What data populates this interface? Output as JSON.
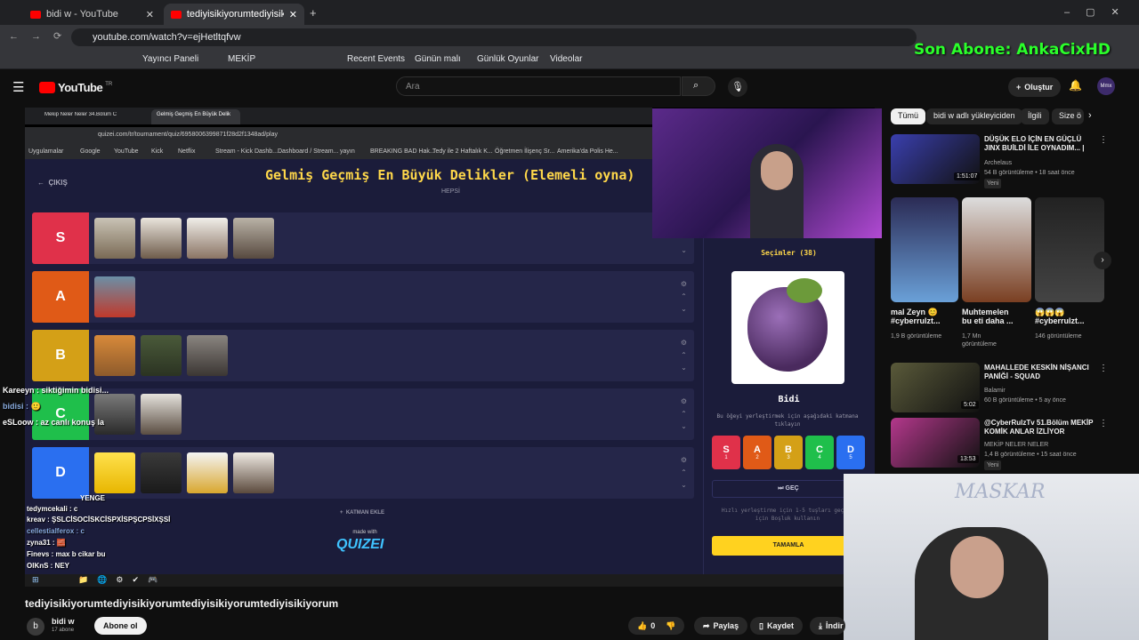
{
  "browser": {
    "tabs": [
      {
        "label": "bidi w - YouTube"
      },
      {
        "label": "tediyisikiyorumtediyisikiyor"
      }
    ],
    "url": "youtube.com/watch?v=ejHetltqfvw",
    "bookmarks": [
      "Yayıncı Paneli",
      "MEKİP",
      "Recent Events",
      "Günün malı",
      "Günlük Oyunlar",
      "Videolar"
    ]
  },
  "overlay": {
    "subscriber_text": "Son Abone: AnkaCixHD"
  },
  "youtube": {
    "logo": "YouTube",
    "logo_region": "TR",
    "search_placeholder": "Ara",
    "create_label": "Oluştur",
    "avatar_text": "Mmx"
  },
  "stream": {
    "inner_tabs": [
      "Mekip Neler Neler 34.Bölüm C",
      "Gelmiş Geçmiş En Büyük Delik"
    ],
    "inner_url": "quizei.com/tr/tournament/quiz/6958006399871f28d2f1348ad/play",
    "inner_bookmarks": [
      "Uygulamalar",
      "Google",
      "YouTube",
      "Kick",
      "Netflix",
      "Stream - Kick Dashb...",
      "Dashboard / Stream...",
      "yayın",
      "BREAKING BAD Hak...",
      "Tedy ile 2 Haftalık K...",
      "Öğretmen İlişenç Sr...",
      "Amerika'da Polis He..."
    ],
    "quiz": {
      "back_label": "ÇIKIŞ",
      "title": "Gelmiş Geçmiş En Büyük Delikler (Elemeli oyna)",
      "subtitle": "HEPSİ",
      "tiers": [
        {
          "label": "S",
          "color": "#e0314a"
        },
        {
          "label": "A",
          "color": "#e05a17"
        },
        {
          "label": "B",
          "color": "#d4a017"
        },
        {
          "label": "C",
          "color": "#1fbf4b"
        },
        {
          "label": "D",
          "color": "#2a6ff0"
        }
      ],
      "add_layer_label": "KATMAN EKLE",
      "made_with": "made with",
      "brand": "QUIZEI",
      "selections_label": "Seçimler (38)",
      "current_item": "Bidi",
      "instruction": "Bu öğeyi yerleştirmek için aşağıdaki katmana tıklayın",
      "tier_buttons": [
        {
          "label": "S",
          "key": "1",
          "color": "#e0314a"
        },
        {
          "label": "A",
          "key": "2",
          "color": "#e05a17"
        },
        {
          "label": "B",
          "key": "3",
          "color": "#d4a017"
        },
        {
          "label": "C",
          "key": "4",
          "color": "#1fbf4b"
        },
        {
          "label": "D",
          "key": "5",
          "color": "#2a6ff0"
        }
      ],
      "skip_label": "GEÇ",
      "hint": "Hızlı yerleştirme için 1-5 tuşları geçmek için Boşluk kullanın",
      "finish_label": "TAMAMLA"
    },
    "chat": [
      {
        "text": "Kareeyn : siktiğimin bidisi..."
      },
      {
        "text": "bidisi : 🙂"
      },
      {
        "text": "eSLoow : az canlı konuş la"
      },
      {
        "text": "YENGE"
      },
      {
        "text": "tedymcekali : c"
      },
      {
        "text": "kreav : ŞSLCİSOCİSKCİSPXİSPŞCPSİXŞSİ"
      },
      {
        "text": "cellestialferox : c"
      },
      {
        "text": "zyna31 : 🧱"
      },
      {
        "text": "Finevs : max b cikar bu"
      },
      {
        "text": "OlKnS : NEY"
      }
    ],
    "cam_label": "MASKAR"
  },
  "recommend": {
    "chips": [
      "Tümü",
      "bidi w adlı yükleyiciden",
      "İlgili",
      "Size ö"
    ],
    "videos": [
      {
        "title": "DÜŞÜK ELO İÇİN EN GÜÇLÜ JINX BUİLDİ İLE OYNADIM... |",
        "channel": "Archelaus",
        "meta": "54 B görüntüleme • 18 saat önce",
        "badge": "Yeni",
        "duration": "1:51:07",
        "thumb": "#3a3fae"
      },
      {
        "title": "MAHALLEDE KESKİN NİŞANCI PANİĞİ - SQUAD",
        "channel": "Balamir",
        "meta": "60 B görüntüleme • 5 ay önce",
        "badge": "",
        "duration": "5:02",
        "thumb": "#5a5a3a"
      },
      {
        "title": "@CyberRulzTv 51.Bölüm MEKİP KOMİK ANLAR İZLİYOR",
        "channel": "MEKİP NELER NELER",
        "meta": "1,4 B görüntüleme • 15 saat önce",
        "badge": "Yeni",
        "duration": "13:53",
        "thumb": "#b4388c"
      }
    ],
    "shorts": [
      {
        "title": "mal Zeyn 😊 #cyberrulzt...",
        "views": "1,9 B görüntüleme"
      },
      {
        "title": "Muhtemelen bu eti daha ...",
        "views": "1,7 Mn görüntüleme"
      },
      {
        "title": "😱😱😱 #cyberrulzt...",
        "views": "146 görüntüleme"
      }
    ]
  },
  "video": {
    "title": "tediyisikiyorumtediyisikiyorumtediyisikiyorumtediyisikiyorum",
    "channel": "bidi w",
    "subs": "17 abone",
    "subscribe_label": "Abone ol",
    "likes": "0",
    "share_label": "Paylaş",
    "save_label": "Kaydet",
    "download_label": "İndir"
  }
}
